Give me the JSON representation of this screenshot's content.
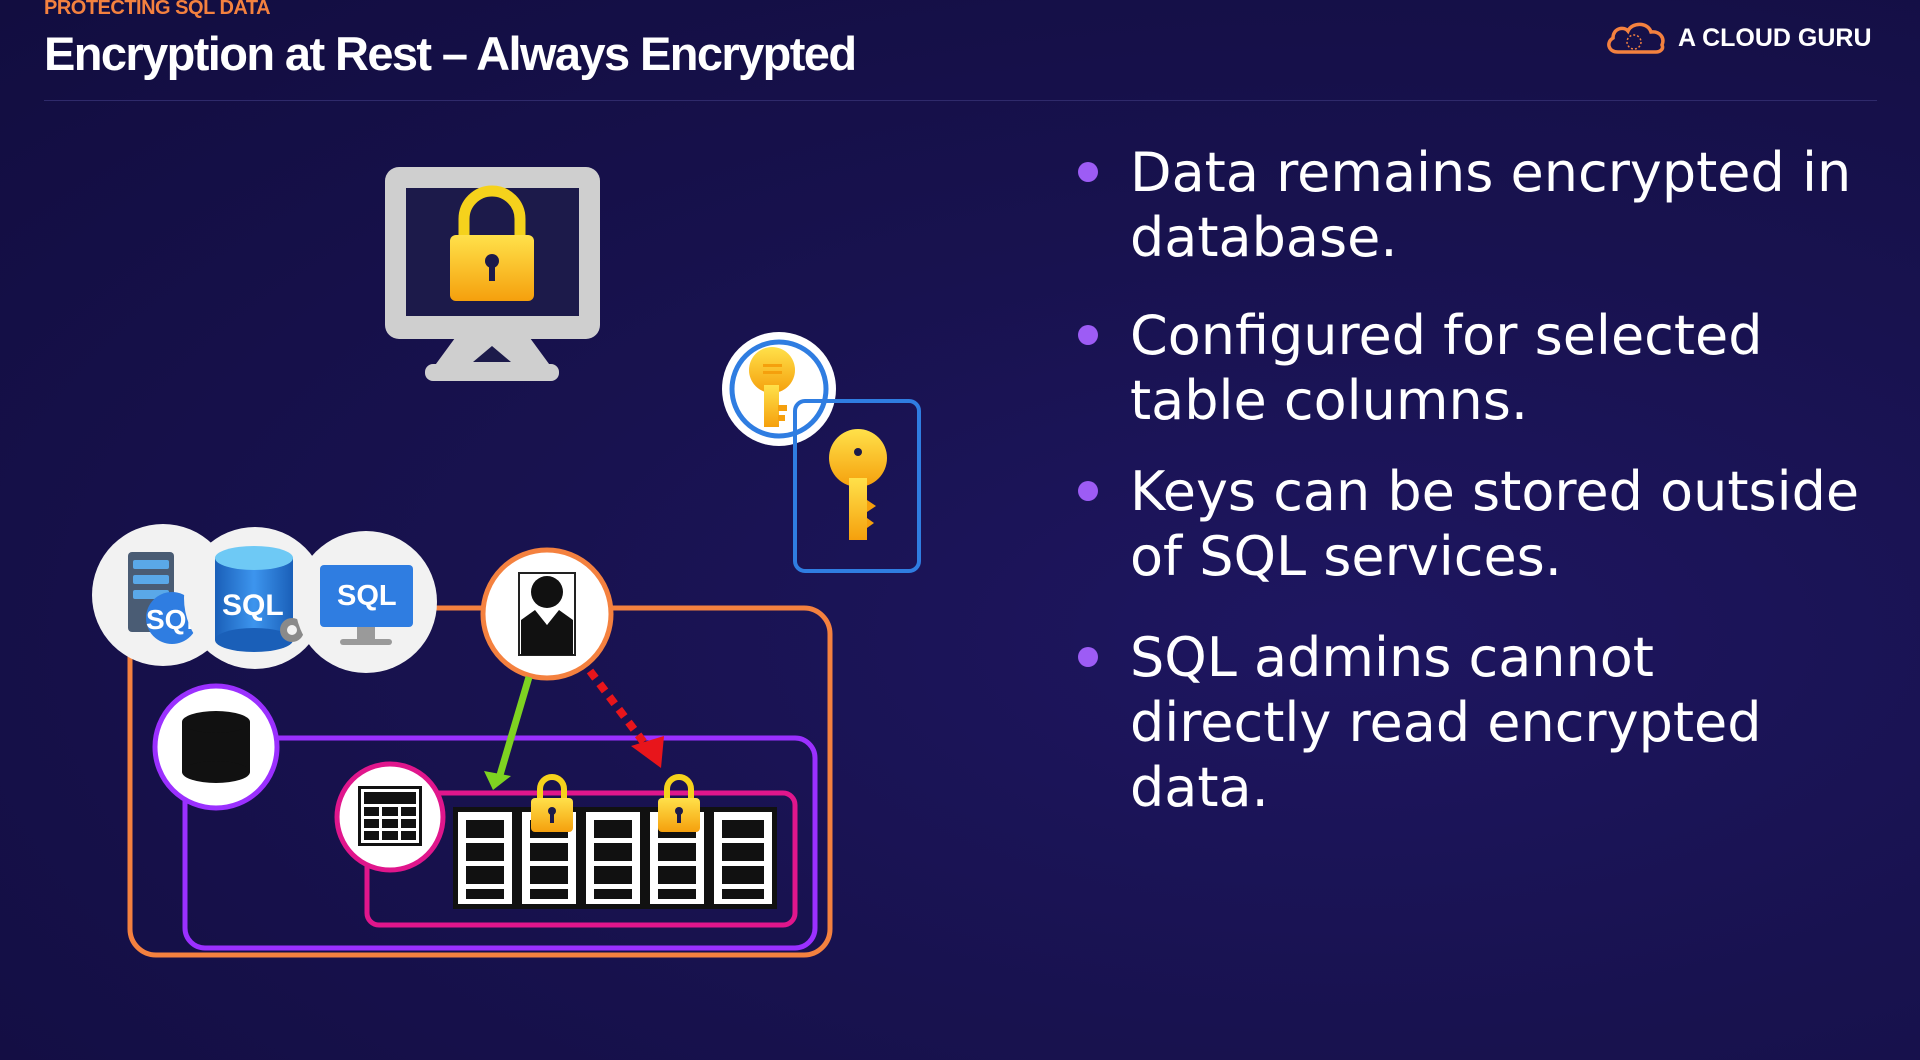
{
  "header": {
    "kicker": "PROTECTING SQL DATA",
    "title": "Encryption at Rest – Always Encrypted"
  },
  "brand": {
    "name": "A CLOUD GURU",
    "logo_icon": "cloud-icon",
    "accent_color": "#f4813f"
  },
  "diagram": {
    "sql_labels": [
      "SQL",
      "SQL",
      "SQL"
    ],
    "colors": {
      "orange": "#f4813f",
      "purple": "#9b30ff",
      "magenta": "#e0168c",
      "blue": "#2f7de1",
      "green": "#7ed321",
      "red": "#e8151b",
      "gold": "#f5b912"
    }
  },
  "bullets": [
    {
      "text": "Data remains encrypted in database."
    },
    {
      "text": "Configured for selected table columns."
    },
    {
      "text": "Keys can be stored outside of SQL services."
    },
    {
      "text": "SQL admins cannot directly read encrypted data."
    }
  ],
  "bullet_color": "#9d5cf5"
}
